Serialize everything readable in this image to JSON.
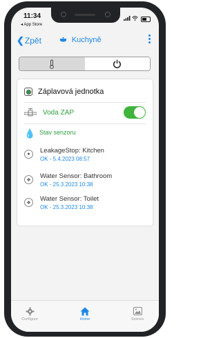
{
  "status_bar": {
    "time": "11:34",
    "back_app": "◂ App Store"
  },
  "nav": {
    "back_label": "Zpět",
    "room_title": "Kuchyně"
  },
  "segments": [
    {
      "icon": "thermometer-icon",
      "selected": true
    },
    {
      "icon": "power-icon",
      "selected": false
    }
  ],
  "device": {
    "title": "Záplavová jednotka"
  },
  "valve": {
    "label": "Voda ZAP",
    "enabled": true
  },
  "sensors_header": "Stav senzoru",
  "sensors": [
    {
      "name": "LeakageStop: Kitchen",
      "status": "OK - 5.4.2023 08:57"
    },
    {
      "name": "Water Sensor: Bathroom",
      "status": "OK - 25.3.2023 10:38"
    },
    {
      "name": "Water Sensor: Toilet",
      "status": "OK - 25.3.2023 10:38"
    }
  ],
  "tabs": [
    {
      "label": "Configure",
      "icon": "gear-icon",
      "active": false
    },
    {
      "label": "Home",
      "icon": "home-icon",
      "active": true
    },
    {
      "label": "Scenes",
      "icon": "scenes-icon",
      "active": false
    }
  ],
  "colors": {
    "accent_blue": "#1e88e5",
    "accent_green": "#3fb43b"
  }
}
